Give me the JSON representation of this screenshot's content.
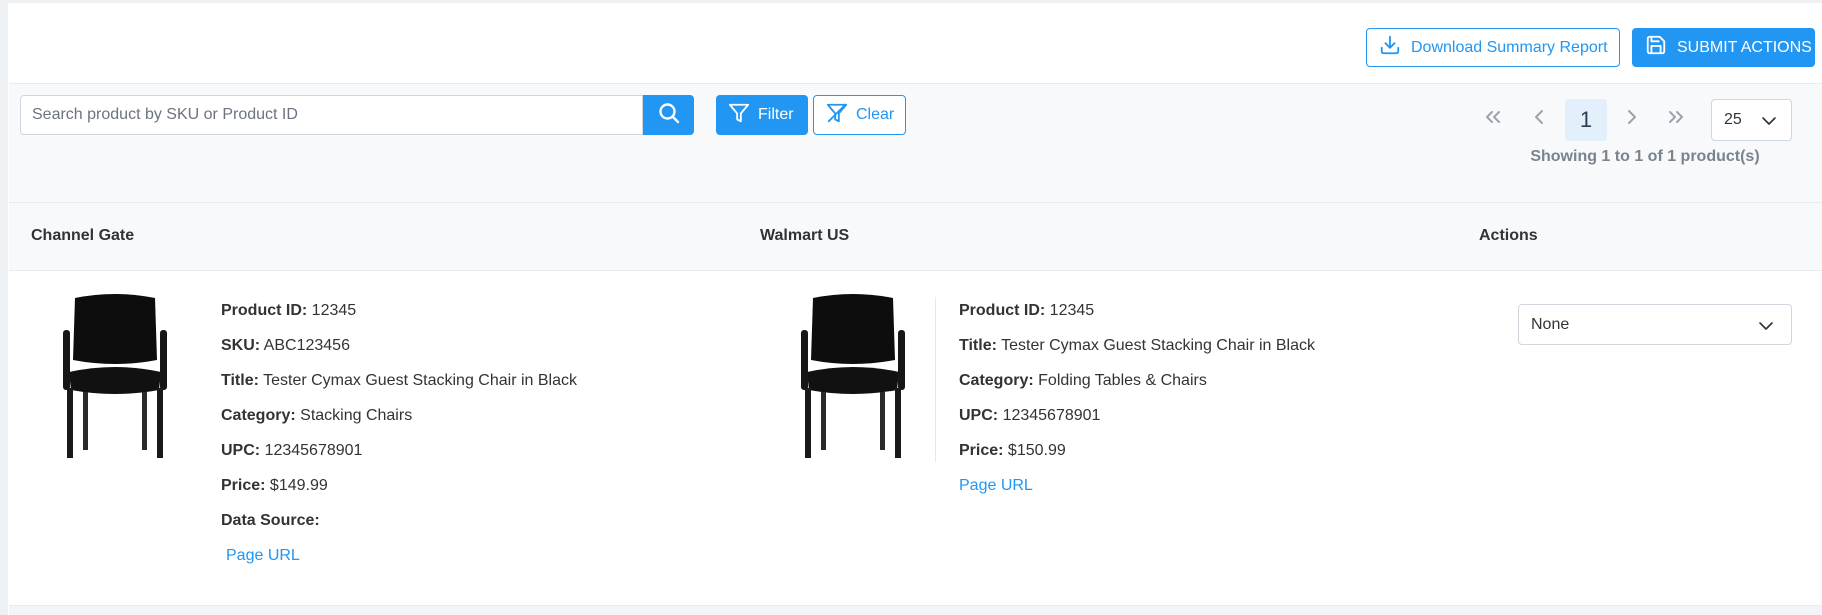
{
  "header": {
    "download_label": "Download Summary Report",
    "submit_label": "SUBMIT ACTIONS"
  },
  "toolbar": {
    "search_placeholder": "Search product by SKU or Product ID",
    "filter_label": "Filter",
    "clear_label": "Clear"
  },
  "pagination": {
    "current_page": "1",
    "page_size": "25",
    "showing_text": "Showing 1 to 1 of 1 product(s)"
  },
  "columns": {
    "col1": "Channel Gate",
    "col2": "Walmart US",
    "col3": "Actions"
  },
  "channel_gate": {
    "product_id_label": "Product ID:",
    "product_id": "12345",
    "sku_label": "SKU:",
    "sku": "ABC123456",
    "title_label": "Title:",
    "title": "Tester Cymax Guest Stacking Chair in Black",
    "category_label": "Category:",
    "category": "Stacking Chairs",
    "upc_label": "UPC:",
    "upc": "12345678901",
    "price_label": "Price:",
    "price": "$149.99",
    "data_source_label": "Data Source:",
    "page_url_label": "Page URL"
  },
  "walmart": {
    "product_id_label": "Product ID:",
    "product_id": "12345",
    "title_label": "Title:",
    "title": "Tester Cymax Guest Stacking Chair in Black",
    "category_label": "Category:",
    "category": "Folding Tables & Chairs",
    "upc_label": "UPC:",
    "upc": "12345678901",
    "price_label": "Price:",
    "price": "$150.99",
    "page_url_label": "Page URL"
  },
  "actions": {
    "selected": "None"
  },
  "colors": {
    "primary": "#2196f3",
    "toolbar_bg": "#f7f9fb",
    "muted_text": "#7a848f"
  }
}
